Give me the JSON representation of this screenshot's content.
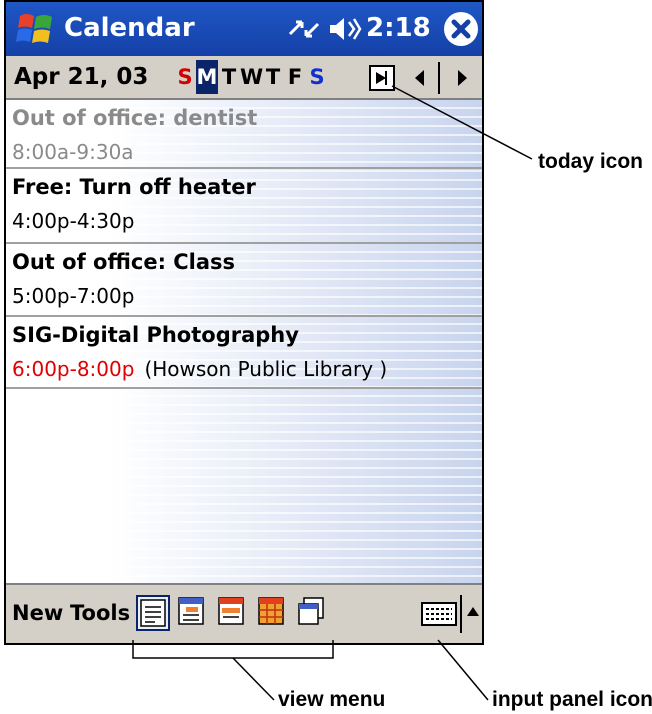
{
  "titlebar": {
    "app_title": "Calendar",
    "time": "2:18"
  },
  "datebar": {
    "date": "Apr 21, 03",
    "days": [
      "S",
      "M",
      "T",
      "W",
      "T",
      "F",
      "S"
    ],
    "selected_day_index": 1
  },
  "appointments": [
    {
      "title": "Out of office: dentist",
      "time": "8:00a-9:30a",
      "location": ""
    },
    {
      "title": "Free: Turn off heater",
      "time": "4:00p-4:30p",
      "location": ""
    },
    {
      "title": "Out of office: Class",
      "time": "5:00p-7:00p",
      "location": ""
    },
    {
      "title": "SIG-Digital Photography",
      "time": "6:00p-8:00p",
      "location": "(Howson Public Library )"
    }
  ],
  "toolbar": {
    "new_label": "New",
    "tools_label": "Tools"
  },
  "callouts": {
    "today_icon": "today icon",
    "view_menu": "view menu",
    "input_panel_icon": "input panel icon"
  },
  "icons": [
    "windows-start-icon",
    "sync-icon",
    "speaker-icon",
    "close-icon",
    "today-icon",
    "chevron-left-icon",
    "chevron-right-icon",
    "agenda-view-icon",
    "day-view-icon",
    "week-view-icon",
    "month-view-icon",
    "year-view-icon",
    "keyboard-icon",
    "arrow-up-icon"
  ],
  "colors": {
    "titlebar": "#1f57c5",
    "sunday": "#d40000",
    "saturday": "#1030d0",
    "selected_day": "#0a246a",
    "appointment_time_red": "#e00000"
  }
}
